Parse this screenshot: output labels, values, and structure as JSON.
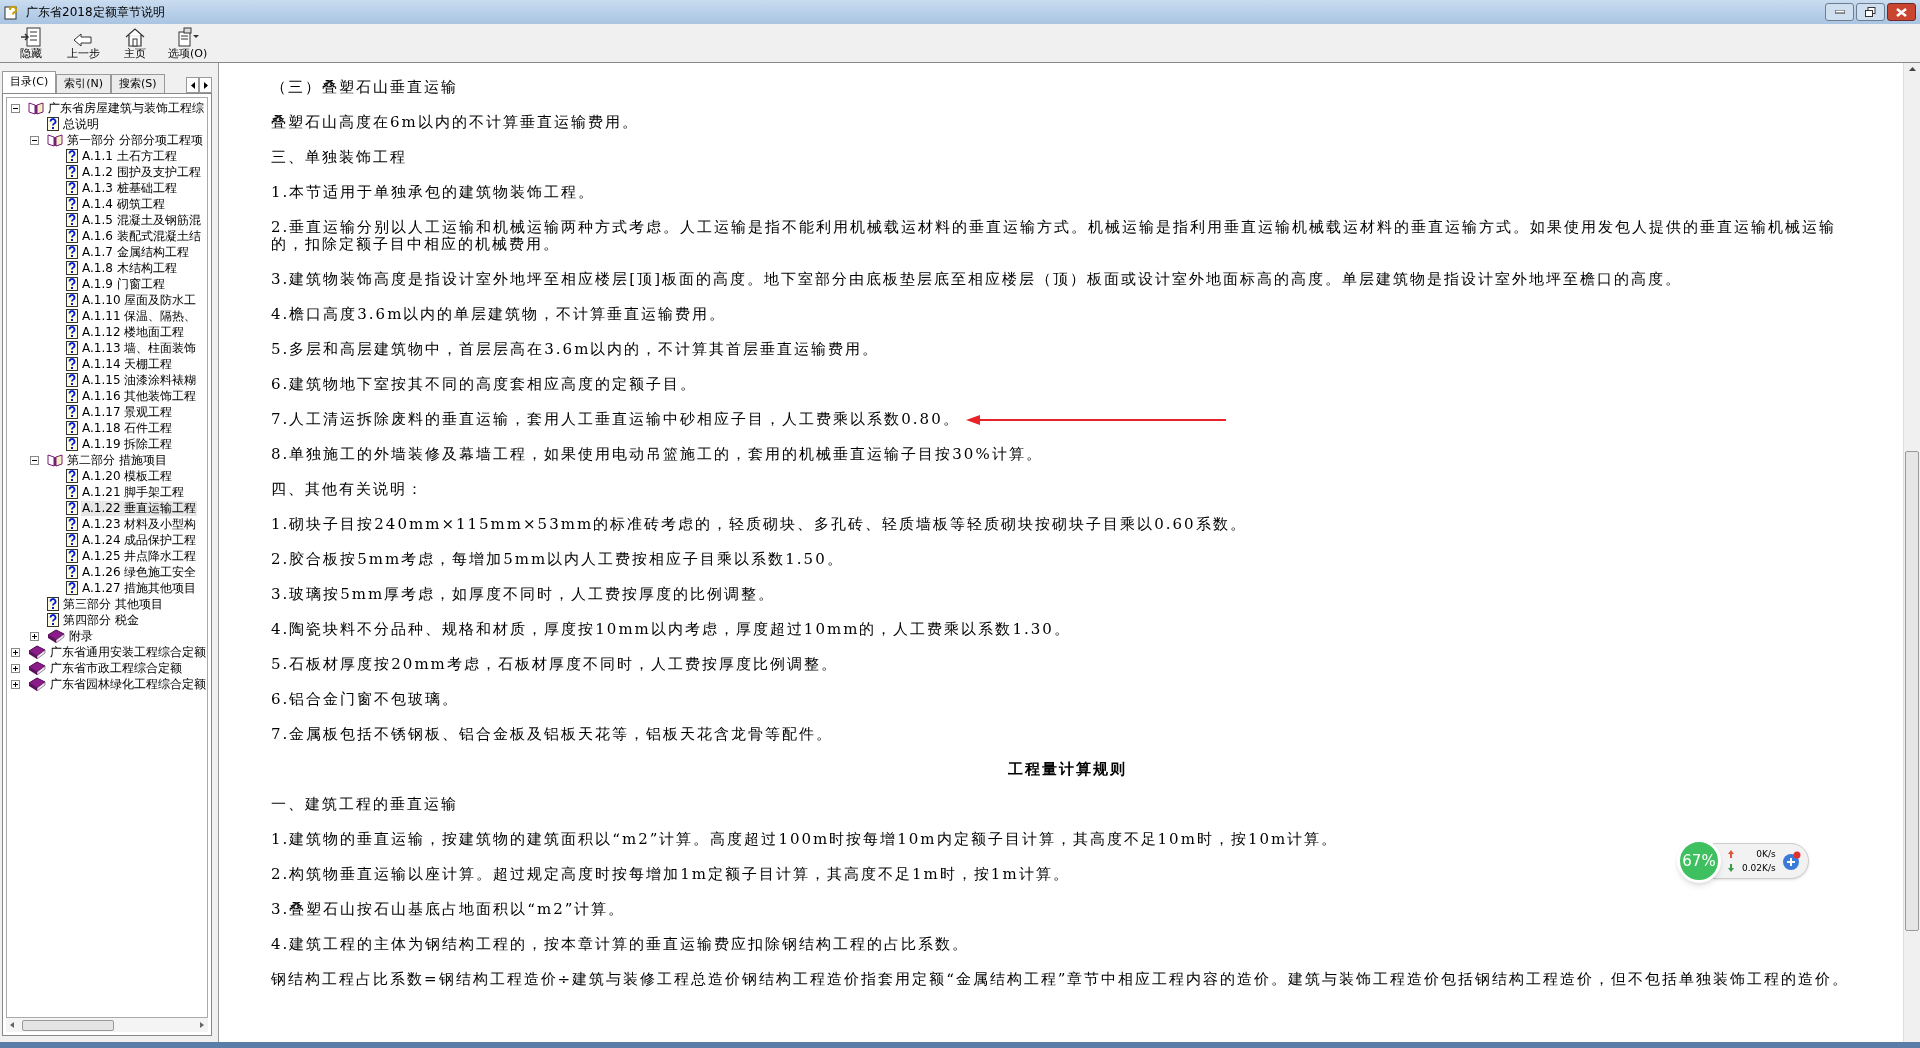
{
  "window": {
    "title": "广东省2018定额章节说明"
  },
  "toolbar": [
    {
      "label": "隐藏",
      "kind": "hide"
    },
    {
      "label": "上一步",
      "kind": "back"
    },
    {
      "label": "主页",
      "kind": "home"
    },
    {
      "label": "选项(O)",
      "kind": "options"
    }
  ],
  "tabs": [
    {
      "label": "目录(C)",
      "selected": true
    },
    {
      "label": "索引(N)",
      "selected": false
    },
    {
      "label": "搜索(S)",
      "selected": false
    }
  ],
  "tree": [
    {
      "label": "广东省房屋建筑与装饰工程综",
      "kind": "book",
      "expanded": true,
      "selected": false,
      "children": [
        {
          "label": "总说明",
          "kind": "page",
          "selected": false
        },
        {
          "label": "第一部分 分部分项工程项",
          "kind": "book",
          "expanded": true,
          "selected": false,
          "children": [
            {
              "label": "A.1.1 土石方工程",
              "kind": "page",
              "selected": false
            },
            {
              "label": "A.1.2 围护及支护工程",
              "kind": "page",
              "selected": false
            },
            {
              "label": "A.1.3 桩基础工程",
              "kind": "page",
              "selected": false
            },
            {
              "label": "A.1.4 砌筑工程",
              "kind": "page",
              "selected": false
            },
            {
              "label": "A.1.5 混凝土及钢筋混",
              "kind": "page",
              "selected": false
            },
            {
              "label": "A.1.6 装配式混凝土结",
              "kind": "page",
              "selected": false
            },
            {
              "label": "A.1.7 金属结构工程",
              "kind": "page",
              "selected": false
            },
            {
              "label": "A.1.8 木结构工程",
              "kind": "page",
              "selected": false
            },
            {
              "label": "A.1.9 门窗工程",
              "kind": "page",
              "selected": false
            },
            {
              "label": "A.1.10 屋面及防水工",
              "kind": "page",
              "selected": false
            },
            {
              "label": "A.1.11 保温、隔热、",
              "kind": "page",
              "selected": false
            },
            {
              "label": "A.1.12 楼地面工程",
              "kind": "page",
              "selected": false
            },
            {
              "label": "A.1.13 墙、柱面装饰",
              "kind": "page",
              "selected": false
            },
            {
              "label": "A.1.14 天棚工程",
              "kind": "page",
              "selected": false
            },
            {
              "label": "A.1.15 油漆涂料裱糊",
              "kind": "page",
              "selected": false
            },
            {
              "label": "A.1.16 其他装饰工程",
              "kind": "page",
              "selected": false
            },
            {
              "label": "A.1.17 景观工程",
              "kind": "page",
              "selected": false
            },
            {
              "label": "A.1.18 石件工程",
              "kind": "page",
              "selected": false
            },
            {
              "label": "A.1.19 拆除工程",
              "kind": "page",
              "selected": false
            }
          ]
        },
        {
          "label": "第二部分 措施项目",
          "kind": "book",
          "expanded": true,
          "selected": false,
          "children": [
            {
              "label": "A.1.20 模板工程",
              "kind": "page",
              "selected": false
            },
            {
              "label": "A.1.21 脚手架工程",
              "kind": "page",
              "selected": false
            },
            {
              "label": "A.1.22 垂直运输工程",
              "kind": "page",
              "selected": true
            },
            {
              "label": "A.1.23 材料及小型构",
              "kind": "page",
              "selected": false
            },
            {
              "label": "A.1.24 成品保护工程",
              "kind": "page",
              "selected": false
            },
            {
              "label": "A.1.25 井点降水工程",
              "kind": "page",
              "selected": false
            },
            {
              "label": "A.1.26 绿色施工安全",
              "kind": "page",
              "selected": false
            },
            {
              "label": "A.1.27 措施其他项目",
              "kind": "page",
              "selected": false
            }
          ]
        },
        {
          "label": "第三部分 其他项目",
          "kind": "page",
          "selected": false
        },
        {
          "label": "第四部分 税金",
          "kind": "page",
          "selected": false
        },
        {
          "label": "附录",
          "kind": "book",
          "expanded": false,
          "selected": false
        }
      ]
    },
    {
      "label": "广东省通用安装工程综合定额",
      "kind": "book",
      "expanded": false,
      "selected": false
    },
    {
      "label": "广东省市政工程综合定额",
      "kind": "book",
      "expanded": false,
      "selected": false
    },
    {
      "label": "广东省园林绿化工程综合定额",
      "kind": "book",
      "expanded": false,
      "selected": false
    }
  ],
  "content": [
    {
      "kind": "text",
      "text": "（三）叠塑石山垂直运输"
    },
    {
      "kind": "text",
      "text": "叠塑石山高度在6m以内的不计算垂直运输费用。"
    },
    {
      "kind": "text",
      "text": "三、单独装饰工程"
    },
    {
      "kind": "text",
      "text": "1.本节适用于单独承包的建筑物装饰工程。"
    },
    {
      "kind": "text",
      "text": "2.垂直运输分别以人工运输和机械运输两种方式考虑。人工运输是指不能利用机械载运材料的垂直运输方式。机械运输是指利用垂直运输机械载运材料的垂直运输方式。如果使用发包人提供的垂直运输机械运输的，扣除定额子目中相应的机械费用。"
    },
    {
      "kind": "text",
      "text": "3.建筑物装饰高度是指设计室外地坪至相应楼层[顶]板面的高度。地下室部分由底板垫层底至相应楼层（顶）板面或设计室外地面标高的高度。单层建筑物是指设计室外地坪至檐口的高度。"
    },
    {
      "kind": "text",
      "text": "4.檐口高度3.6m以内的单层建筑物，不计算垂直运输费用。"
    },
    {
      "kind": "text",
      "text": "5.多层和高层建筑物中，首层层高在3.6m以内的，不计算其首层垂直运输费用。"
    },
    {
      "kind": "text",
      "text": "6.建筑物地下室按其不同的高度套相应高度的定额子目。"
    },
    {
      "kind": "marked",
      "text": "7.人工清运拆除废料的垂直运输，套用人工垂直运输中砂相应子目，人工费乘以系数0.80。"
    },
    {
      "kind": "text",
      "text": "8.单独施工的外墙装修及幕墙工程，如果使用电动吊篮施工的，套用的机械垂直运输子目按30%计算。"
    },
    {
      "kind": "text",
      "text": "四、其他有关说明："
    },
    {
      "kind": "text",
      "text": "1.砌块子目按240mm×115mm×53mm的标准砖考虑的，轻质砌块、多孔砖、轻质墙板等轻质砌块按砌块子目乘以0.60系数。"
    },
    {
      "kind": "text",
      "text": "2.胶合板按5mm考虑，每增加5mm以内人工费按相应子目乘以系数1.50。"
    },
    {
      "kind": "text",
      "text": "3.玻璃按5mm厚考虑，如厚度不同时，人工费按厚度的比例调整。"
    },
    {
      "kind": "text",
      "text": "4.陶瓷块料不分品种、规格和材质，厚度按10mm以内考虑，厚度超过10mm的，人工费乘以系数1.30。"
    },
    {
      "kind": "text",
      "text": "5.石板材厚度按20mm考虑，石板材厚度不同时，人工费按厚度比例调整。"
    },
    {
      "kind": "text",
      "text": "6.铝合金门窗不包玻璃。"
    },
    {
      "kind": "text",
      "text": "7.金属板包括不锈钢板、铝合金板及铝板天花等，铝板天花含龙骨等配件。"
    },
    {
      "kind": "heading",
      "text": "工程量计算规则"
    },
    {
      "kind": "text",
      "text": "一、建筑工程的垂直运输"
    },
    {
      "kind": "text",
      "text": "1.建筑物的垂直运输，按建筑物的建筑面积以“m2”计算。高度超过100m时按每增10m内定额子目计算，其高度不足10m时，按10m计算。"
    },
    {
      "kind": "text",
      "text": "2.构筑物垂直运输以座计算。超过规定高度时按每增加1m定额子目计算，其高度不足1m时，按1m计算。"
    },
    {
      "kind": "text",
      "text": "3.叠塑石山按石山基底占地面积以“m2”计算。"
    },
    {
      "kind": "text",
      "text": "4.建筑工程的主体为钢结构工程的，按本章计算的垂直运输费应扣除钢结构工程的占比系数。"
    },
    {
      "kind": "text",
      "text": "钢结构工程占比系数=钢结构工程造价÷建筑与装修工程总造价钢结构工程造价指套用定额“金属结构工程”章节中相应工程内容的造价。建筑与装饰工程造价包括钢结构工程造价，但不包括单独装饰工程的造价。"
    }
  ],
  "speed_widget": {
    "percent": "67%",
    "upload": "0K/s",
    "download": "0.02K/s"
  }
}
